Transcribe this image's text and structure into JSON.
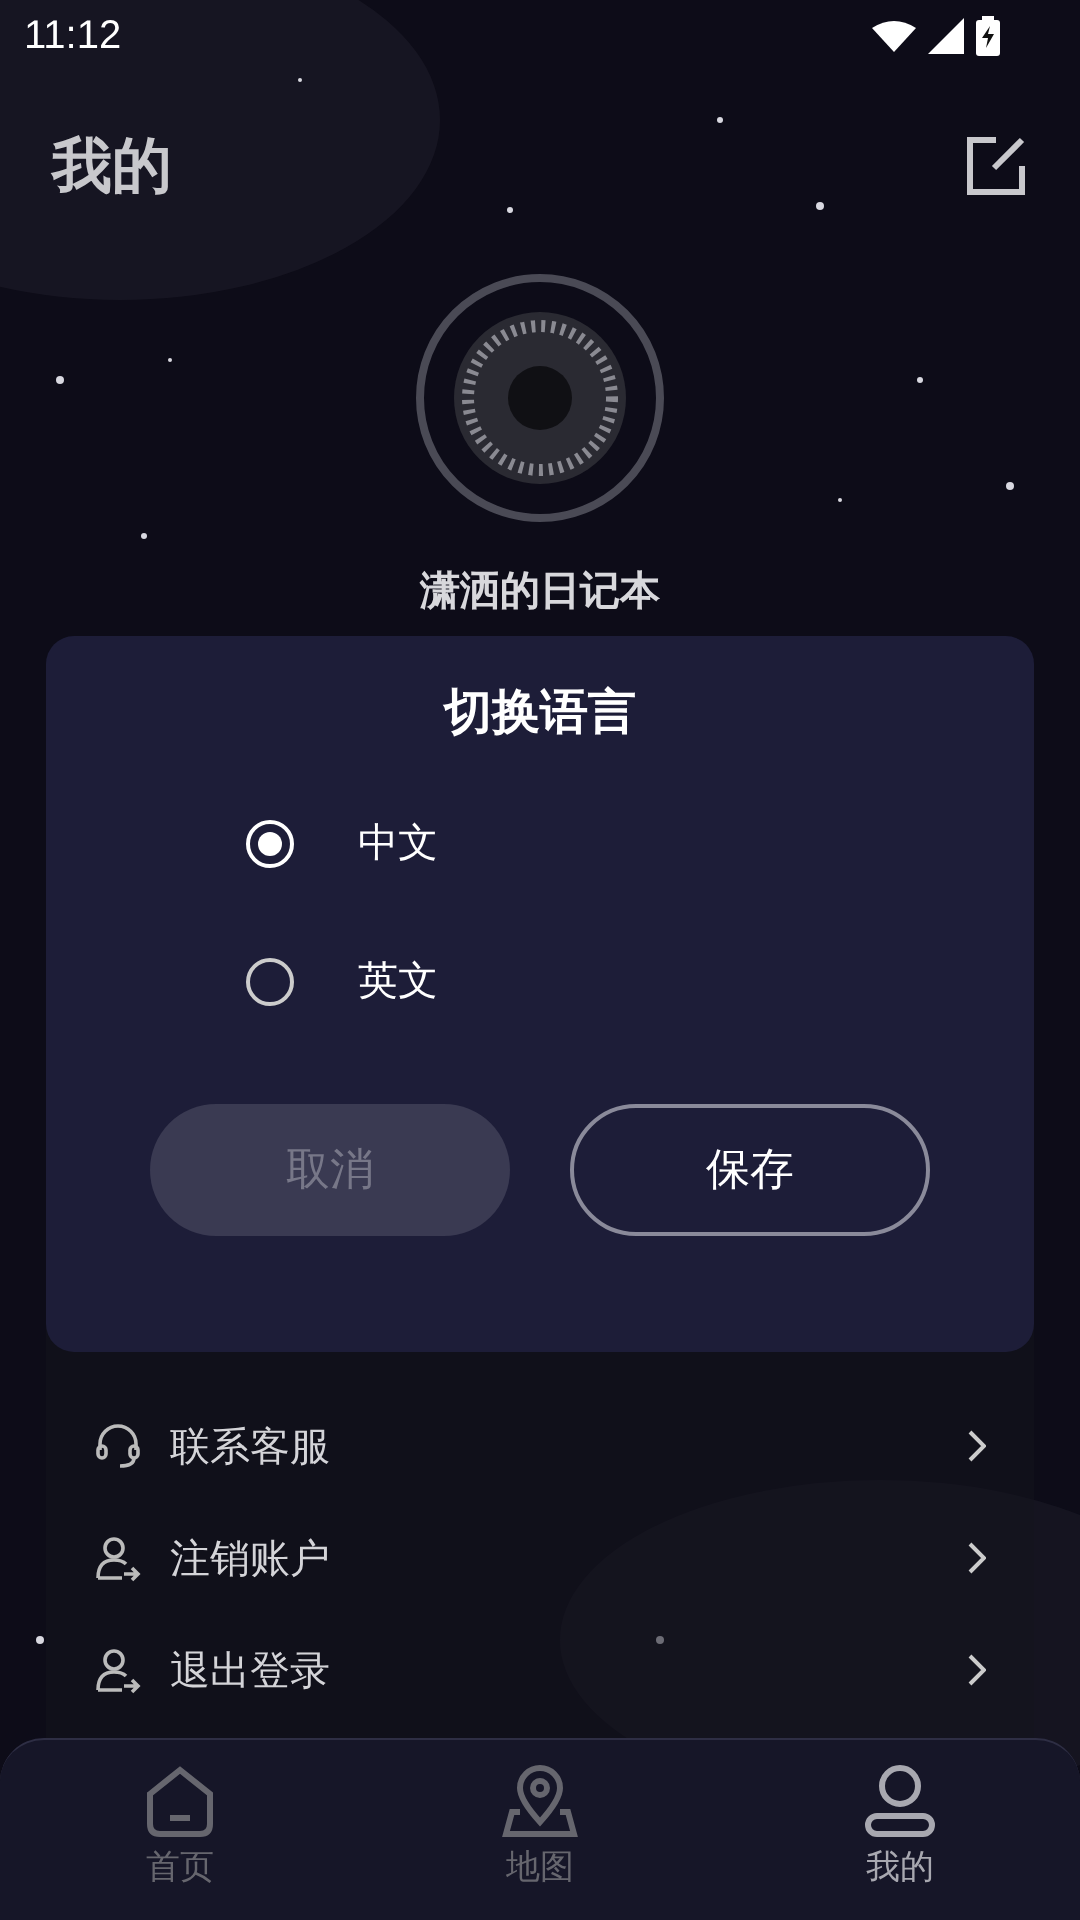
{
  "status_bar": {
    "time": "11:12"
  },
  "header": {
    "title": "我的"
  },
  "profile": {
    "name": "潇洒的日记本"
  },
  "menu": [
    {
      "label": "联系客服"
    },
    {
      "label": "注销账户"
    },
    {
      "label": "退出登录"
    }
  ],
  "dialog": {
    "title": "切换语言",
    "options": [
      {
        "label": "中文",
        "selected": true
      },
      {
        "label": "英文",
        "selected": false
      }
    ],
    "buttons": [
      {
        "label": "取消",
        "kind": "secondary"
      },
      {
        "label": "保存",
        "kind": "primary"
      }
    ]
  },
  "tabs": [
    {
      "label": "首页",
      "selected": false
    },
    {
      "label": "地图",
      "selected": false
    },
    {
      "label": "我的",
      "selected": true
    }
  ]
}
